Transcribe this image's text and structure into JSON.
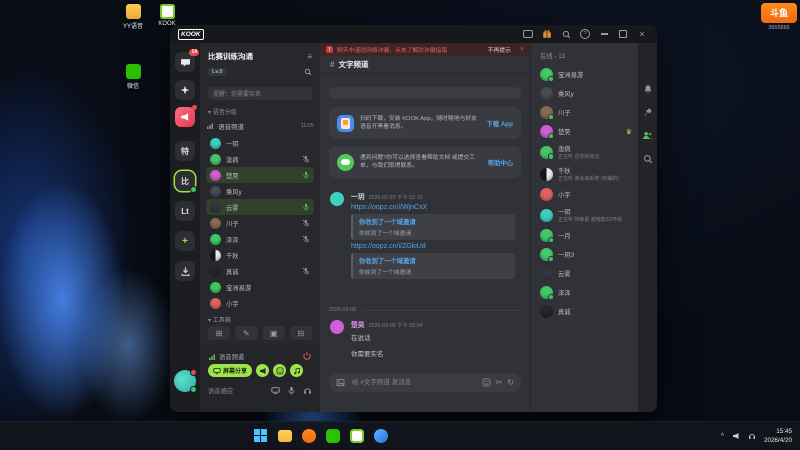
{
  "colors": {
    "accent_green": "#9ee44c",
    "link_blue": "#54a4e4",
    "danger_red": "#e05a5a",
    "online_green": "#3ac569",
    "banner_red": "#e06060",
    "watermark_orange": "#f06a12"
  },
  "watermark": {
    "logo": "斗鱼",
    "id": "3655865"
  },
  "desktop_icons": [
    {
      "label": "YY语音"
    },
    {
      "label": "KOOK"
    },
    {
      "label": "微信"
    }
  ],
  "titlebar": {
    "brand": "KOOK"
  },
  "rail": {
    "chat_badge": "14",
    "servers": [
      {
        "label": "特"
      },
      {
        "label": "比"
      },
      {
        "label": "Lt"
      }
    ]
  },
  "sidebar": {
    "server_name": "比赛训练沟通",
    "level": "Lv.0",
    "notice": "提醒：你需要实名",
    "group_label": "语音分组",
    "channel": {
      "name": "语音频道",
      "count": "11/25"
    },
    "members": [
      {
        "name": "一玥",
        "mic": "none"
      },
      {
        "name": "泼病",
        "mic": "muted"
      },
      {
        "name": "楚昊",
        "mic": "on"
      },
      {
        "name": "乘风y",
        "mic": "none"
      },
      {
        "name": "云雾",
        "mic": "on"
      },
      {
        "name": "川子",
        "mic": "muted"
      },
      {
        "name": "泽泽",
        "mic": "muted"
      },
      {
        "name": "千秋",
        "mic": "none"
      },
      {
        "name": "真诚",
        "mic": "muted"
      },
      {
        "name": "宝洲易游",
        "mic": "none"
      },
      {
        "name": "小宇",
        "mic": "none"
      }
    ],
    "toolbox_label": "工具箱",
    "voice": {
      "title": "语音频道",
      "screen_share": "屏幕分享",
      "mode_label": "语音感应"
    }
  },
  "chat": {
    "banner": {
      "text": "聊天中谨防网络诈骗，点击了解防诈骗指南",
      "dismiss": "不再提示"
    },
    "channel": "文字频道",
    "promos": [
      {
        "text": "扫码下载，安装 KOOK App，随时随地与好友语音开黑看消息。",
        "link": "下载 App"
      },
      {
        "text": "遇到问题?你可以选择查看帮助文档 或提交工单，与我们取得联系。",
        "link": "帮助中心"
      }
    ],
    "messages": {
      "m1": {
        "author": "一玥",
        "time": "2026-02-25 下午 02:19",
        "link1": "https://oopz.cn/i/WjnCxX",
        "link2": "https://oopz.cn/i/ZGkiUd",
        "card_title": "你收到了一个域邀请",
        "card_sub": "你收到了一个域邀请"
      },
      "divider": "2026-03-06",
      "m2": {
        "author": "楚昊",
        "time": "2026-03-06 下午 03:04",
        "line1": "在说话",
        "line2": "你需要实名"
      }
    },
    "input_placeholder": "给 #文字频道 发消息"
  },
  "panel": {
    "header": "在线 - 13",
    "members": [
      {
        "name": "宝洲易游"
      },
      {
        "name": "乘风y"
      },
      {
        "name": "川子"
      },
      {
        "name": "楚昊"
      },
      {
        "name": "泼病",
        "activity": "正在听 在你的身边"
      },
      {
        "name": "千秋",
        "activity": "正在听 谁会来拆穿 (你编的)"
      },
      {
        "name": "小宇"
      },
      {
        "name": "一玥",
        "activity": "正在听 阿砵夏 越南鼓3D环绕"
      },
      {
        "name": "一月"
      },
      {
        "name": "一玥3"
      },
      {
        "name": "云雾"
      },
      {
        "name": "泽泽"
      },
      {
        "name": "真诚"
      }
    ]
  },
  "taskbar": {
    "time": "15:45",
    "date": "2026/4/20"
  }
}
